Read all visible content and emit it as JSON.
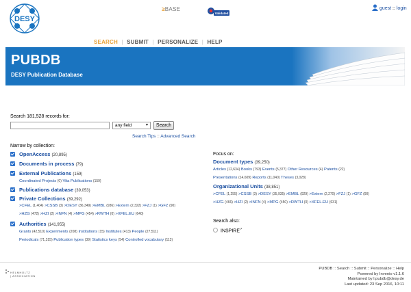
{
  "header": {
    "logo_text": "DESY",
    "base_label": "BASE",
    "validated_label": "Validated",
    "user_links": [
      "guest",
      "login"
    ],
    "user_sep": "::"
  },
  "nav": {
    "items": [
      "SEARCH",
      "SUBMIT",
      "PERSONALIZE",
      "HELP"
    ],
    "sep": "|",
    "active_index": 0
  },
  "banner": {
    "title": "PUBDB",
    "subtitle": "DESY Publication Database",
    "bg_color": "#1a74c0"
  },
  "search": {
    "label": "Search 181,528 records for:",
    "input_value": "",
    "field_value": "any field",
    "button_label": "Search",
    "tips_link": "Search Tips",
    "links_sep": "::",
    "advanced_link": "Advanced Search"
  },
  "collections": {
    "label": "Narrow by collection:",
    "items": [
      {
        "name": "OpenAccess",
        "count": "(20,895)",
        "checked": true
      },
      {
        "name": "Documents in process",
        "count": "(79)",
        "checked": true
      },
      {
        "name": "External Publications",
        "count": "(159)",
        "checked": true,
        "subs": [
          [
            {
              "name": "Coordinated Projects",
              "count": "(0)"
            },
            {
              "name": "Vita Publications",
              "count": "(159)"
            }
          ]
        ]
      },
      {
        "name": "Publications database",
        "count": "(39,053)",
        "checked": true
      },
      {
        "name": "Private Collections",
        "count": "(39,292)",
        "checked": true,
        "subs": [
          [
            {
              "name": ">CFEL",
              "count": "(1,404)"
            },
            {
              "name": ">CSSB",
              "count": "(3)"
            },
            {
              "name": ">DESY",
              "count": "(36,349)"
            },
            {
              "name": ">EMBL",
              "count": "(936)"
            },
            {
              "name": ">Extern",
              "count": "(2,322)"
            },
            {
              "name": ">FZJ",
              "count": "(1)"
            },
            {
              "name": ">GFZ",
              "count": "(90)"
            }
          ],
          [
            {
              "name": ">HZG",
              "count": "(472)"
            },
            {
              "name": ">HZI",
              "count": "(2)"
            },
            {
              "name": ">INFN",
              "count": "(4)"
            },
            {
              "name": ">MPG",
              "count": "(454)"
            },
            {
              "name": ">RWTH",
              "count": "(0)"
            },
            {
              "name": ">XFEL.EU",
              "count": "(640)"
            }
          ]
        ]
      },
      {
        "name": "Authorities",
        "count": "(141,955)",
        "checked": true,
        "subs": [
          [
            {
              "name": "Grants",
              "count": "(42,510)"
            },
            {
              "name": "Experiments",
              "count": "(208)"
            },
            {
              "name": "Institutions",
              "count": "(15)"
            },
            {
              "name": "Institutes",
              "count": "(413)"
            },
            {
              "name": "People",
              "count": "(27,511)"
            }
          ],
          [
            {
              "name": "Periodicals",
              "count": "(71,315)"
            },
            {
              "name": "Publication types",
              "count": "(39)"
            },
            {
              "name": "Statistics keys",
              "count": "(54)"
            },
            {
              "name": "Controlled vocabulary",
              "count": "(113)"
            }
          ]
        ]
      }
    ]
  },
  "focus": {
    "label": "Focus on:",
    "items": [
      {
        "name": "Document types",
        "count": "(39,250)",
        "subs": [
          [
            {
              "name": "Articles",
              "count": "(12,634)"
            },
            {
              "name": "Books",
              "count": "(793)"
            },
            {
              "name": "Events",
              "count": "(5,377)"
            },
            {
              "name": "Other Resources",
              "count": "(4)"
            },
            {
              "name": "Patents",
              "count": "(22)"
            }
          ],
          [
            {
              "name": "Presentations",
              "count": "(14,609)"
            },
            {
              "name": "Reports",
              "count": "(11,040)"
            },
            {
              "name": "Theses",
              "count": "(3,028)"
            }
          ]
        ]
      },
      {
        "name": "Organizational Units",
        "count": "(38,851)",
        "subs": [
          [
            {
              "name": ">CFEL",
              "count": "(1,255)"
            },
            {
              "name": ">CSSB",
              "count": "(3)"
            },
            {
              "name": ">DESY",
              "count": "(35,935)"
            },
            {
              "name": ">EMBL",
              "count": "(929)"
            },
            {
              "name": ">Extern",
              "count": "(2,270)"
            },
            {
              "name": ">FZJ",
              "count": "(1)"
            },
            {
              "name": ">GFZ",
              "count": "(90)"
            }
          ],
          [
            {
              "name": ">HZG",
              "count": "(466)"
            },
            {
              "name": ">HZI",
              "count": "(2)"
            },
            {
              "name": ">INFN",
              "count": "(4)"
            },
            {
              "name": ">MPG",
              "count": "(450)"
            },
            {
              "name": ">RWTH",
              "count": "(0)"
            },
            {
              "name": ">XFEL.EU",
              "count": "(631)"
            }
          ]
        ]
      }
    ]
  },
  "search_also": {
    "label": "Search also:",
    "option": "INSPIRE",
    "option_mark": "ext"
  },
  "footer": {
    "helmholtz_lines": [
      "HELMHOLTZ",
      "| ASSOCIATION"
    ],
    "links": [
      "PUBDB",
      "Search",
      "Submit",
      "Personalize",
      "Help"
    ],
    "links_sep": "::",
    "powered_by": "Powered by Invenio v1.1.6",
    "maintained_by": "Maintained by l.pubdb@desy.de",
    "last_updated": "Last updated: 23 Sep 2016, 10:11"
  },
  "icons": [
    "desy-logo",
    "base-logo",
    "validated-badge",
    "user-icon",
    "helmholtz-logo",
    "external-link-icon"
  ]
}
